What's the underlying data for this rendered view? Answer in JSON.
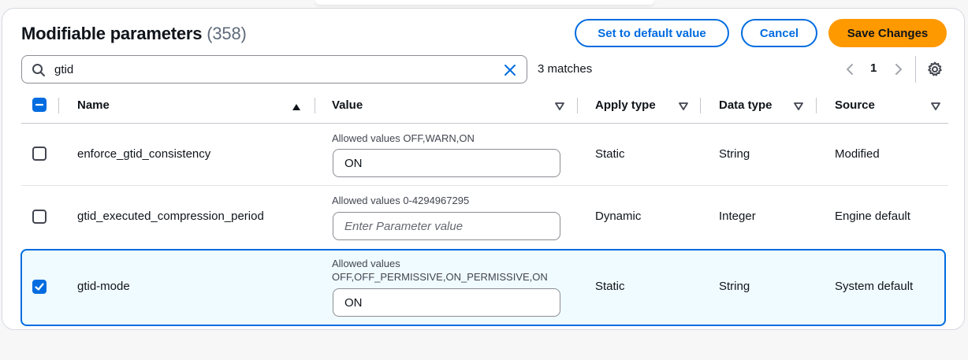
{
  "header": {
    "title": "Modifiable parameters",
    "count": "(358)",
    "set_default_label": "Set to default value",
    "cancel_label": "Cancel",
    "save_label": "Save Changes"
  },
  "search": {
    "value": "gtid",
    "matches": "3 matches"
  },
  "pagination": {
    "current_page": "1"
  },
  "table": {
    "columns": [
      "Name",
      "Value",
      "Apply type",
      "Data type",
      "Source"
    ],
    "rows": [
      {
        "name": "enforce_gtid_consistency",
        "hint": "Allowed values OFF,WARN,ON",
        "value": "ON",
        "apply_type": "Static",
        "data_type": "String",
        "source": "Modified",
        "selected": false
      },
      {
        "name": "gtid_executed_compression_period",
        "hint": "Allowed values 0-4294967295",
        "value": "",
        "placeholder": "Enter Parameter value",
        "apply_type": "Dynamic",
        "data_type": "Integer",
        "source": "Engine default",
        "selected": false
      },
      {
        "name": "gtid-mode",
        "hint_line1": "Allowed values",
        "hint_line2": "OFF,OFF_PERMISSIVE,ON_PERMISSIVE,ON",
        "value": "ON",
        "apply_type": "Static",
        "data_type": "String",
        "source": "System default",
        "selected": true
      }
    ]
  },
  "icons": {
    "search": "search-icon",
    "clear": "close-icon",
    "prev": "chevron-left-icon",
    "next": "chevron-right-icon",
    "settings": "gear-icon",
    "sort_asc": "sort-ascending-icon",
    "sort": "sort-caret-icon",
    "check": "checkmark-icon",
    "indeterminate": "minus-icon"
  },
  "colors": {
    "accent": "#006ce0",
    "primary_button": "#ff9900",
    "selected_row_bg": "#f0fbff"
  }
}
